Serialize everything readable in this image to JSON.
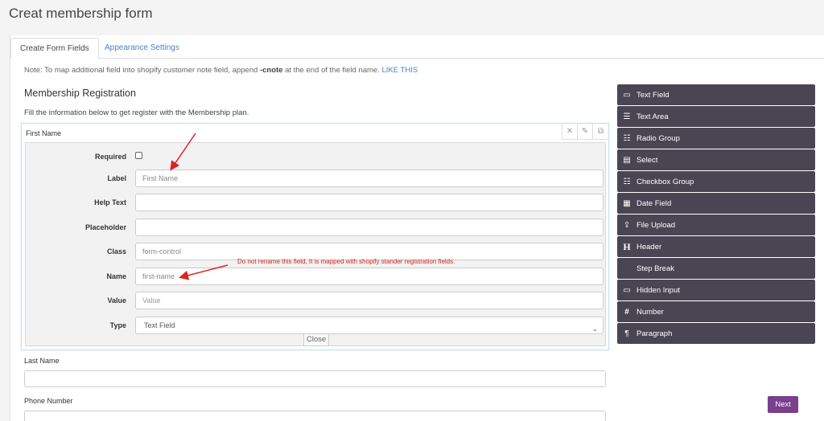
{
  "page": {
    "title": "Creat membership form"
  },
  "tabs": [
    {
      "label": "Create Form Fields",
      "active": true
    },
    {
      "label": "Appearance Settings",
      "active": false
    }
  ],
  "note": {
    "prefix": "Note: To map additional field into shopify customer note field, append ",
    "code": "-cnote",
    "suffix": " at the end of the field name. ",
    "link": "LIKE THIS"
  },
  "form": {
    "title": "Membership Registration",
    "description": "Fill the information below to get register with the Membership plan."
  },
  "field_editor": {
    "field_label": "First Name",
    "rows": {
      "required": "Required",
      "label": "Label",
      "help_text": "Help Text",
      "placeholder": "Placeholder",
      "class": "Class",
      "name": "Name",
      "value": "Value",
      "type": "Type"
    },
    "values": {
      "label": "First Name",
      "help_text": "",
      "placeholder": "",
      "class": "form-control",
      "name": "first-name",
      "value_placeholder": "Value",
      "type": "Text Field"
    },
    "close_label": "Close",
    "required_checked": false
  },
  "annotation": "Do not rename this field, It is mapped with shopify stander registration fields.",
  "other_fields": [
    {
      "label": "Last Name"
    },
    {
      "label": "Phone Number"
    }
  ],
  "palette": [
    {
      "label": "Text Field",
      "icon": "text-field-icon",
      "glyph": "▭"
    },
    {
      "label": "Text Area",
      "icon": "text-area-icon",
      "glyph": "☰"
    },
    {
      "label": "Radio Group",
      "icon": "radio-group-icon",
      "glyph": "☷"
    },
    {
      "label": "Select",
      "icon": "select-icon",
      "glyph": "▤"
    },
    {
      "label": "Checkbox Group",
      "icon": "checkbox-group-icon",
      "glyph": "☷"
    },
    {
      "label": "Date Field",
      "icon": "calendar-icon",
      "glyph": "▦"
    },
    {
      "label": "File Upload",
      "icon": "upload-icon",
      "glyph": "⇪"
    },
    {
      "label": "Header",
      "icon": "header-icon",
      "glyph": "H"
    },
    {
      "label": "Step Break",
      "icon": "",
      "glyph": ""
    },
    {
      "label": "Hidden Input",
      "icon": "hidden-input-icon",
      "glyph": "▭"
    },
    {
      "label": "Number",
      "icon": "number-icon",
      "glyph": "#"
    },
    {
      "label": "Paragraph",
      "icon": "paragraph-icon",
      "glyph": "¶"
    }
  ],
  "next_label": "Next",
  "colors": {
    "palette_bg": "#4a4553",
    "next_button": "#7b3f8d",
    "link": "#4a7fd1",
    "annotation": "#dd2222"
  }
}
